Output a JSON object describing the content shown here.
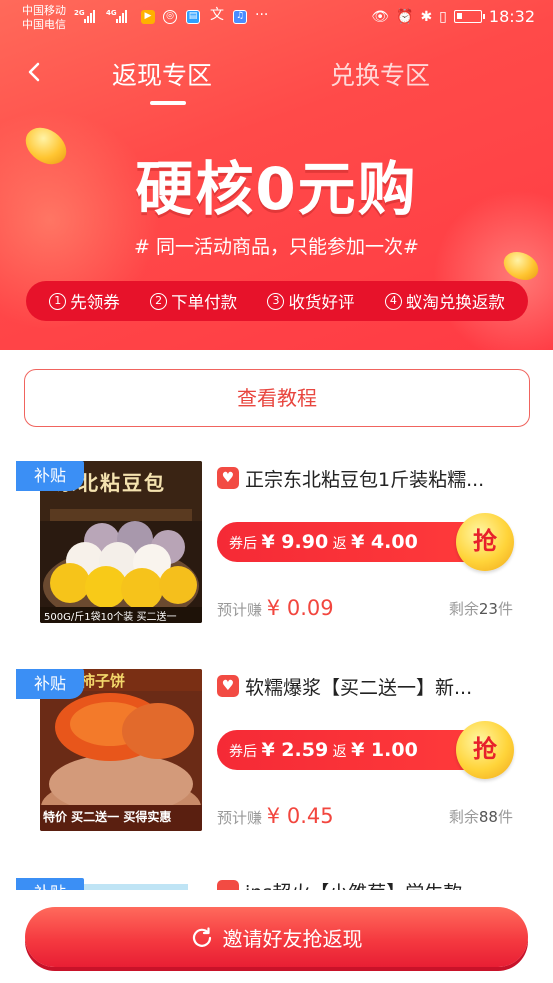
{
  "status_bar": {
    "carrier_1": "中国移动",
    "carrier_2": "中国电信",
    "net_1": "2G",
    "net_2": "4G",
    "time": "18:32",
    "icons": [
      "signal-icon",
      "video-icon",
      "music-icon",
      "book-icon",
      "translate-icon",
      "app-icon",
      "more-icon",
      "eye-icon",
      "alarm-icon",
      "bluetooth-icon",
      "vibrate-icon",
      "battery-icon"
    ]
  },
  "nav": {
    "tabs": [
      {
        "label": "返现专区",
        "active": true
      },
      {
        "label": "兑换专区",
        "active": false
      }
    ]
  },
  "hero": {
    "title": "硬核0元购",
    "subtitle": "# 同一活动商品，只能参加一次#"
  },
  "steps": [
    {
      "num": "1",
      "label": "先领券"
    },
    {
      "num": "2",
      "label": "下单付款"
    },
    {
      "num": "3",
      "label": "收货好评"
    },
    {
      "num": "4",
      "label": "蚁淘兑换返款"
    }
  ],
  "tutorial_button": "查看教程",
  "products": [
    {
      "badge": "补贴",
      "title": "正宗东北粘豆包1斤装粘糯...",
      "image_text_top": "东北粘豆包",
      "image_text_bottom": "500G/斤1袋10个装 买二送一",
      "coupon_label": "券后",
      "price": "¥ 9.90",
      "rebate_label": "返",
      "rebate": "¥ 4.00",
      "grab": "抢",
      "earn_label": "预计赚",
      "earn": "¥ 0.09",
      "remain_label": "剩余",
      "remain": "23",
      "remain_unit": "件"
    },
    {
      "badge": "补贴",
      "title": "软糯爆浆【买二送一】新...",
      "image_text_top": "柿子饼",
      "image_text_bottom": "特价 买二送一 买得实惠",
      "coupon_label": "券后",
      "price": "¥ 2.59",
      "rebate_label": "返",
      "rebate": "¥ 1.00",
      "grab": "抢",
      "earn_label": "预计赚",
      "earn": "¥ 0.45",
      "remain_label": "剩余",
      "remain": "88",
      "remain_unit": "件"
    },
    {
      "badge": "补贴",
      "title": "ins超火【小雏菊】学生款"
    }
  ],
  "invite_button": "邀请好友抢返现",
  "colors": {
    "brand_red": "#ff3b44",
    "subsidy_blue": "#3b8ff5",
    "price_red": "#f2463e",
    "coin_gold": "#ffc531"
  }
}
